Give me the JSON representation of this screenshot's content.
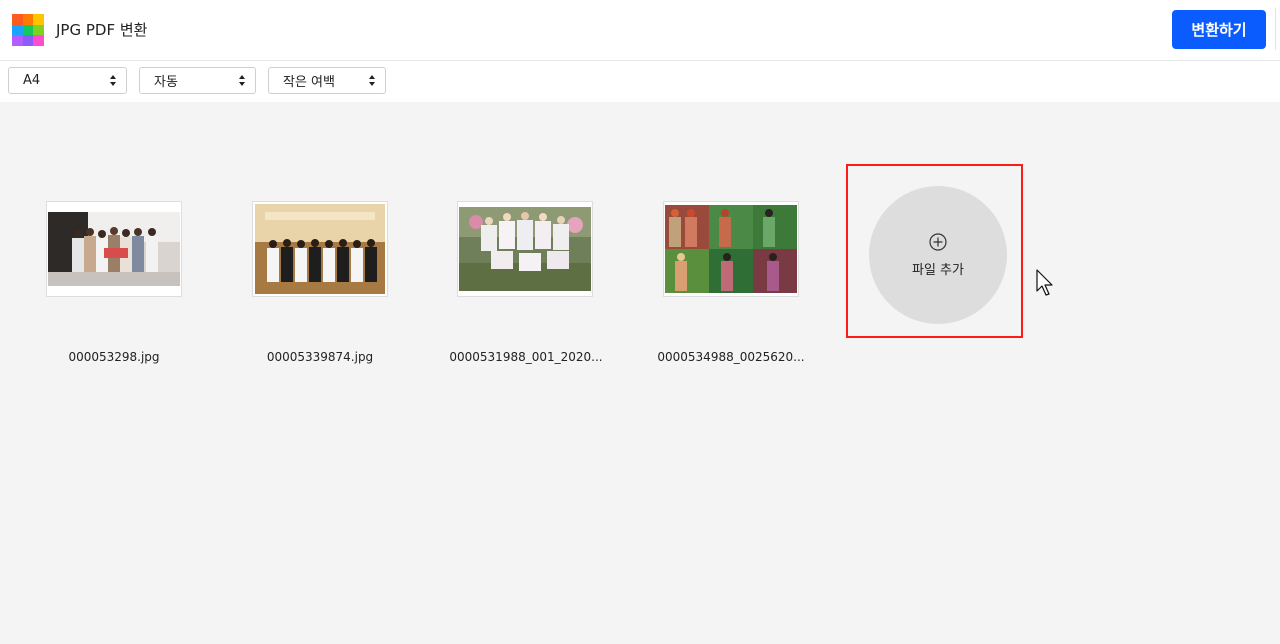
{
  "header": {
    "title": "JPG PDF 변환",
    "convert_label": "변환하기",
    "accent_color": "#0b5cff",
    "logo_colors": [
      "#ff5a1f",
      "#ff7a00",
      "#ffc400",
      "#1aa3ff",
      "#12c95c",
      "#7ed321",
      "#b35cff",
      "#8b5cf6",
      "#ff4dd2"
    ]
  },
  "toolbar": {
    "page_size": "A4",
    "orientation": "자동",
    "margin": "작은 여백"
  },
  "files": [
    {
      "name": "000053298.jpg"
    },
    {
      "name": "00005339874.jpg"
    },
    {
      "name": "0000531988_001_2020..."
    },
    {
      "name": "0000534988_0025620..."
    }
  ],
  "add_file": {
    "label": "파일 추가",
    "icon": "plus-circle-icon",
    "highlight_color": "#ff1a1a"
  }
}
